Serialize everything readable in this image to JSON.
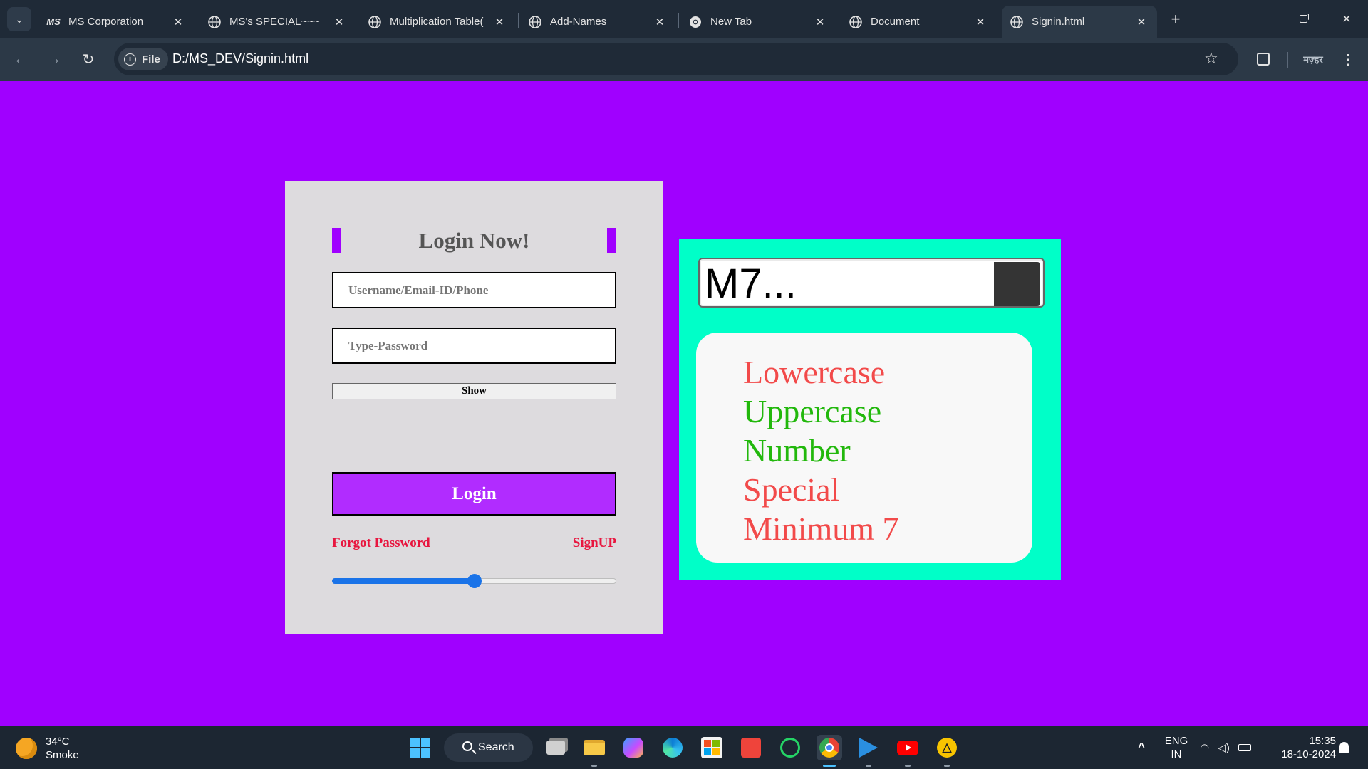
{
  "browser": {
    "tabs": [
      {
        "title": "MS Corporation",
        "icon": "ms-logo-icon",
        "active": false
      },
      {
        "title": "MS's SPECIAL~~~",
        "icon": "globe-icon",
        "active": false
      },
      {
        "title": "Multiplication Table(",
        "icon": "globe-icon",
        "active": false
      },
      {
        "title": "Add-Names",
        "icon": "globe-icon",
        "active": false
      },
      {
        "title": "New Tab",
        "icon": "chrome-icon",
        "active": false
      },
      {
        "title": "Document",
        "icon": "globe-icon",
        "active": false
      },
      {
        "title": "Signin.html",
        "icon": "globe-icon",
        "active": true
      }
    ],
    "favicon_text": "MS",
    "close_glyph": "✕",
    "new_tab_glyph": "+",
    "address": {
      "chip_label": "File",
      "url": "D:/MS_DEV/Signin.html"
    },
    "profile_label": "मज़्हर"
  },
  "login": {
    "title": "Login Now!",
    "username_placeholder": "Username/Email-ID/Phone",
    "password_placeholder": "Type-Password",
    "show_label": "Show",
    "login_label": "Login",
    "forgot_label": "Forgot Password",
    "signup_label": "SignUP",
    "slider_fraction": 0.5
  },
  "strength": {
    "password_display": "M7...",
    "rules": [
      {
        "label": "Lowercase",
        "met": false
      },
      {
        "label": "Uppercase",
        "met": true
      },
      {
        "label": "Number",
        "met": true
      },
      {
        "label": "Special",
        "met": false
      },
      {
        "label": "Minimum 7",
        "met": false
      }
    ]
  },
  "colors": {
    "page_bg": "#a000ff",
    "rule_met": "#22b80c",
    "rule_unmet": "#f24a4a",
    "login_button": "#b12cff",
    "link": "#e8163f",
    "panel_bg": "#00ffc8"
  },
  "taskbar": {
    "weather_temp": "34°C",
    "weather_desc": "Smoke",
    "search_label": "Search",
    "lang_line1": "ENG",
    "lang_line2": "IN",
    "time": "15:35",
    "date": "18-10-2024"
  }
}
